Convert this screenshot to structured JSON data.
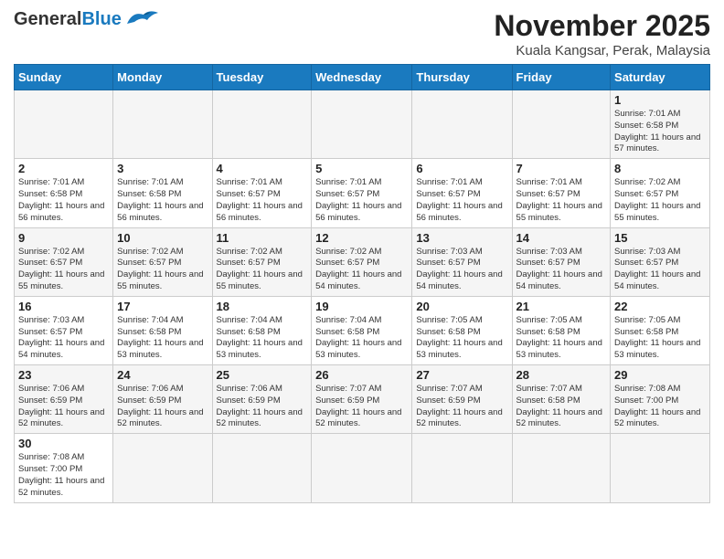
{
  "header": {
    "logo_general": "General",
    "logo_blue": "Blue",
    "month_title": "November 2025",
    "subtitle": "Kuala Kangsar, Perak, Malaysia"
  },
  "weekdays": [
    "Sunday",
    "Monday",
    "Tuesday",
    "Wednesday",
    "Thursday",
    "Friday",
    "Saturday"
  ],
  "weeks": [
    [
      {
        "day": "",
        "sunrise": "",
        "sunset": "",
        "daylight": ""
      },
      {
        "day": "",
        "sunrise": "",
        "sunset": "",
        "daylight": ""
      },
      {
        "day": "",
        "sunrise": "",
        "sunset": "",
        "daylight": ""
      },
      {
        "day": "",
        "sunrise": "",
        "sunset": "",
        "daylight": ""
      },
      {
        "day": "",
        "sunrise": "",
        "sunset": "",
        "daylight": ""
      },
      {
        "day": "",
        "sunrise": "",
        "sunset": "",
        "daylight": ""
      },
      {
        "day": "1",
        "sunrise": "Sunrise: 7:01 AM",
        "sunset": "Sunset: 6:58 PM",
        "daylight": "Daylight: 11 hours and 57 minutes."
      }
    ],
    [
      {
        "day": "2",
        "sunrise": "Sunrise: 7:01 AM",
        "sunset": "Sunset: 6:58 PM",
        "daylight": "Daylight: 11 hours and 56 minutes."
      },
      {
        "day": "3",
        "sunrise": "Sunrise: 7:01 AM",
        "sunset": "Sunset: 6:58 PM",
        "daylight": "Daylight: 11 hours and 56 minutes."
      },
      {
        "day": "4",
        "sunrise": "Sunrise: 7:01 AM",
        "sunset": "Sunset: 6:57 PM",
        "daylight": "Daylight: 11 hours and 56 minutes."
      },
      {
        "day": "5",
        "sunrise": "Sunrise: 7:01 AM",
        "sunset": "Sunset: 6:57 PM",
        "daylight": "Daylight: 11 hours and 56 minutes."
      },
      {
        "day": "6",
        "sunrise": "Sunrise: 7:01 AM",
        "sunset": "Sunset: 6:57 PM",
        "daylight": "Daylight: 11 hours and 56 minutes."
      },
      {
        "day": "7",
        "sunrise": "Sunrise: 7:01 AM",
        "sunset": "Sunset: 6:57 PM",
        "daylight": "Daylight: 11 hours and 55 minutes."
      },
      {
        "day": "8",
        "sunrise": "Sunrise: 7:02 AM",
        "sunset": "Sunset: 6:57 PM",
        "daylight": "Daylight: 11 hours and 55 minutes."
      }
    ],
    [
      {
        "day": "9",
        "sunrise": "Sunrise: 7:02 AM",
        "sunset": "Sunset: 6:57 PM",
        "daylight": "Daylight: 11 hours and 55 minutes."
      },
      {
        "day": "10",
        "sunrise": "Sunrise: 7:02 AM",
        "sunset": "Sunset: 6:57 PM",
        "daylight": "Daylight: 11 hours and 55 minutes."
      },
      {
        "day": "11",
        "sunrise": "Sunrise: 7:02 AM",
        "sunset": "Sunset: 6:57 PM",
        "daylight": "Daylight: 11 hours and 55 minutes."
      },
      {
        "day": "12",
        "sunrise": "Sunrise: 7:02 AM",
        "sunset": "Sunset: 6:57 PM",
        "daylight": "Daylight: 11 hours and 54 minutes."
      },
      {
        "day": "13",
        "sunrise": "Sunrise: 7:03 AM",
        "sunset": "Sunset: 6:57 PM",
        "daylight": "Daylight: 11 hours and 54 minutes."
      },
      {
        "day": "14",
        "sunrise": "Sunrise: 7:03 AM",
        "sunset": "Sunset: 6:57 PM",
        "daylight": "Daylight: 11 hours and 54 minutes."
      },
      {
        "day": "15",
        "sunrise": "Sunrise: 7:03 AM",
        "sunset": "Sunset: 6:57 PM",
        "daylight": "Daylight: 11 hours and 54 minutes."
      }
    ],
    [
      {
        "day": "16",
        "sunrise": "Sunrise: 7:03 AM",
        "sunset": "Sunset: 6:57 PM",
        "daylight": "Daylight: 11 hours and 54 minutes."
      },
      {
        "day": "17",
        "sunrise": "Sunrise: 7:04 AM",
        "sunset": "Sunset: 6:58 PM",
        "daylight": "Daylight: 11 hours and 53 minutes."
      },
      {
        "day": "18",
        "sunrise": "Sunrise: 7:04 AM",
        "sunset": "Sunset: 6:58 PM",
        "daylight": "Daylight: 11 hours and 53 minutes."
      },
      {
        "day": "19",
        "sunrise": "Sunrise: 7:04 AM",
        "sunset": "Sunset: 6:58 PM",
        "daylight": "Daylight: 11 hours and 53 minutes."
      },
      {
        "day": "20",
        "sunrise": "Sunrise: 7:05 AM",
        "sunset": "Sunset: 6:58 PM",
        "daylight": "Daylight: 11 hours and 53 minutes."
      },
      {
        "day": "21",
        "sunrise": "Sunrise: 7:05 AM",
        "sunset": "Sunset: 6:58 PM",
        "daylight": "Daylight: 11 hours and 53 minutes."
      },
      {
        "day": "22",
        "sunrise": "Sunrise: 7:05 AM",
        "sunset": "Sunset: 6:58 PM",
        "daylight": "Daylight: 11 hours and 53 minutes."
      }
    ],
    [
      {
        "day": "23",
        "sunrise": "Sunrise: 7:06 AM",
        "sunset": "Sunset: 6:59 PM",
        "daylight": "Daylight: 11 hours and 52 minutes."
      },
      {
        "day": "24",
        "sunrise": "Sunrise: 7:06 AM",
        "sunset": "Sunset: 6:59 PM",
        "daylight": "Daylight: 11 hours and 52 minutes."
      },
      {
        "day": "25",
        "sunrise": "Sunrise: 7:06 AM",
        "sunset": "Sunset: 6:59 PM",
        "daylight": "Daylight: 11 hours and 52 minutes."
      },
      {
        "day": "26",
        "sunrise": "Sunrise: 7:07 AM",
        "sunset": "Sunset: 6:59 PM",
        "daylight": "Daylight: 11 hours and 52 minutes."
      },
      {
        "day": "27",
        "sunrise": "Sunrise: 7:07 AM",
        "sunset": "Sunset: 6:59 PM",
        "daylight": "Daylight: 11 hours and 52 minutes."
      },
      {
        "day": "28",
        "sunrise": "Sunrise: 7:07 AM",
        "sunset": "Sunset: 6:58 PM",
        "daylight": "Daylight: 11 hours and 52 minutes."
      },
      {
        "day": "29",
        "sunrise": "Sunrise: 7:08 AM",
        "sunset": "Sunset: 7:00 PM",
        "daylight": "Daylight: 11 hours and 52 minutes."
      }
    ],
    [
      {
        "day": "30",
        "sunrise": "Sunrise: 7:08 AM",
        "sunset": "Sunset: 7:00 PM",
        "daylight": "Daylight: 11 hours and 52 minutes."
      },
      {
        "day": "",
        "sunrise": "",
        "sunset": "",
        "daylight": ""
      },
      {
        "day": "",
        "sunrise": "",
        "sunset": "",
        "daylight": ""
      },
      {
        "day": "",
        "sunrise": "",
        "sunset": "",
        "daylight": ""
      },
      {
        "day": "",
        "sunrise": "",
        "sunset": "",
        "daylight": ""
      },
      {
        "day": "",
        "sunrise": "",
        "sunset": "",
        "daylight": ""
      },
      {
        "day": "",
        "sunrise": "",
        "sunset": "",
        "daylight": ""
      }
    ]
  ]
}
